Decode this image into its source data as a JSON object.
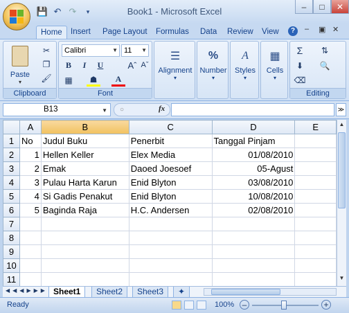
{
  "window": {
    "title": "Book1 - Microsoft Excel"
  },
  "tabs": [
    "Home",
    "Insert",
    "Page Layout",
    "Formulas",
    "Data",
    "Review",
    "View"
  ],
  "ribbon": {
    "clipboard": {
      "label": "Clipboard",
      "paste": "Paste"
    },
    "font": {
      "label": "Font",
      "name": "Calibri",
      "size": "11",
      "bold": "B",
      "italic": "I",
      "underline": "U"
    },
    "alignment": "Alignment",
    "number": "Number",
    "styles": "Styles",
    "cells": "Cells",
    "editing": "Editing"
  },
  "formula": {
    "namebox": "B13",
    "fx": "fx",
    "value": ""
  },
  "columns": [
    "A",
    "B",
    "C",
    "D",
    "E"
  ],
  "rows": [
    {
      "n": "1",
      "a": "No",
      "b": "Judul Buku",
      "c": "Penerbit",
      "d": "Tanggal Pinjam"
    },
    {
      "n": "2",
      "a": "1",
      "b": "Hellen Keller",
      "c": "Elex Media",
      "d": "01/08/2010"
    },
    {
      "n": "3",
      "a": "2",
      "b": "Emak",
      "c": "Daoed Joesoef",
      "d": "05-Agust"
    },
    {
      "n": "4",
      "a": "3",
      "b": "Pulau Harta Karun",
      "c": "Enid Blyton",
      "d": "03/08/2010"
    },
    {
      "n": "5",
      "a": "4",
      "b": "Si Gadis Penakut",
      "c": "Enid Blyton",
      "d": "10/08/2010"
    },
    {
      "n": "6",
      "a": "5",
      "b": "Baginda Raja",
      "c": "H.C. Andersen",
      "d": "02/08/2010"
    },
    {
      "n": "7",
      "a": "",
      "b": "",
      "c": "",
      "d": ""
    },
    {
      "n": "8",
      "a": "",
      "b": "",
      "c": "",
      "d": ""
    },
    {
      "n": "9",
      "a": "",
      "b": "",
      "c": "",
      "d": ""
    },
    {
      "n": "10",
      "a": "",
      "b": "",
      "c": "",
      "d": ""
    },
    {
      "n": "11",
      "a": "",
      "b": "",
      "c": "",
      "d": ""
    }
  ],
  "sheets": [
    "Sheet1",
    "Sheet2",
    "Sheet3"
  ],
  "status": {
    "ready": "Ready",
    "zoom": "100%"
  }
}
